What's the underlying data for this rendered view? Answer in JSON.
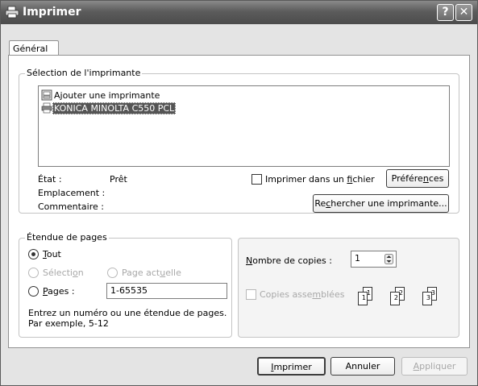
{
  "window": {
    "title": "Imprimer",
    "help_button": "?",
    "close_button": "✕"
  },
  "tabs": [
    {
      "label": "Général"
    }
  ],
  "printer_selection": {
    "title": "Sélection de l'imprimante",
    "printers": [
      {
        "label": "Ajouter une imprimante",
        "selected": false
      },
      {
        "label": "KONICA MINOLTA C550 PCL",
        "selected": true
      }
    ],
    "status_label": "État :",
    "status_value": "Prêt",
    "location_label": "Emplacement :",
    "location_value": "",
    "comment_label": "Commentaire :",
    "comment_value": "",
    "print_to_file_pre": "Imprimer dans un ",
    "print_to_file_u": "f",
    "print_to_file_post": "ichier",
    "print_to_file_checked": false,
    "preferences_pre": "Préfére",
    "preferences_u": "n",
    "preferences_post": "ces",
    "find_printer_pre": "Re",
    "find_printer_u": "c",
    "find_printer_post": "hercher une imprimante..."
  },
  "page_range": {
    "title": "Étendue de pages",
    "all_u": "T",
    "all_post": "out",
    "selection_pre": "Sélecti",
    "selection_u": "o",
    "selection_post": "n",
    "current_pre": "Page act",
    "current_u": "u",
    "current_post": "elle",
    "pages_u": "P",
    "pages_post": "ages :",
    "pages_value": "1-65535",
    "hint_line1": "Entrez un numéro ou une étendue de pages.",
    "hint_line2": "Par exemple, 5-12"
  },
  "copies": {
    "label_u": "N",
    "label_post": "ombre de copies :",
    "value": "1",
    "collate_pre": "Copies asse",
    "collate_u": "m",
    "collate_post": "blées",
    "collate_checked": false,
    "sheet_labels": [
      "1",
      "1",
      "2",
      "2",
      "3",
      "3"
    ]
  },
  "footer": {
    "print_u": "I",
    "print_post": "mprimer",
    "cancel": "Annuler",
    "apply_u": "A",
    "apply_post": "ppliquer"
  }
}
